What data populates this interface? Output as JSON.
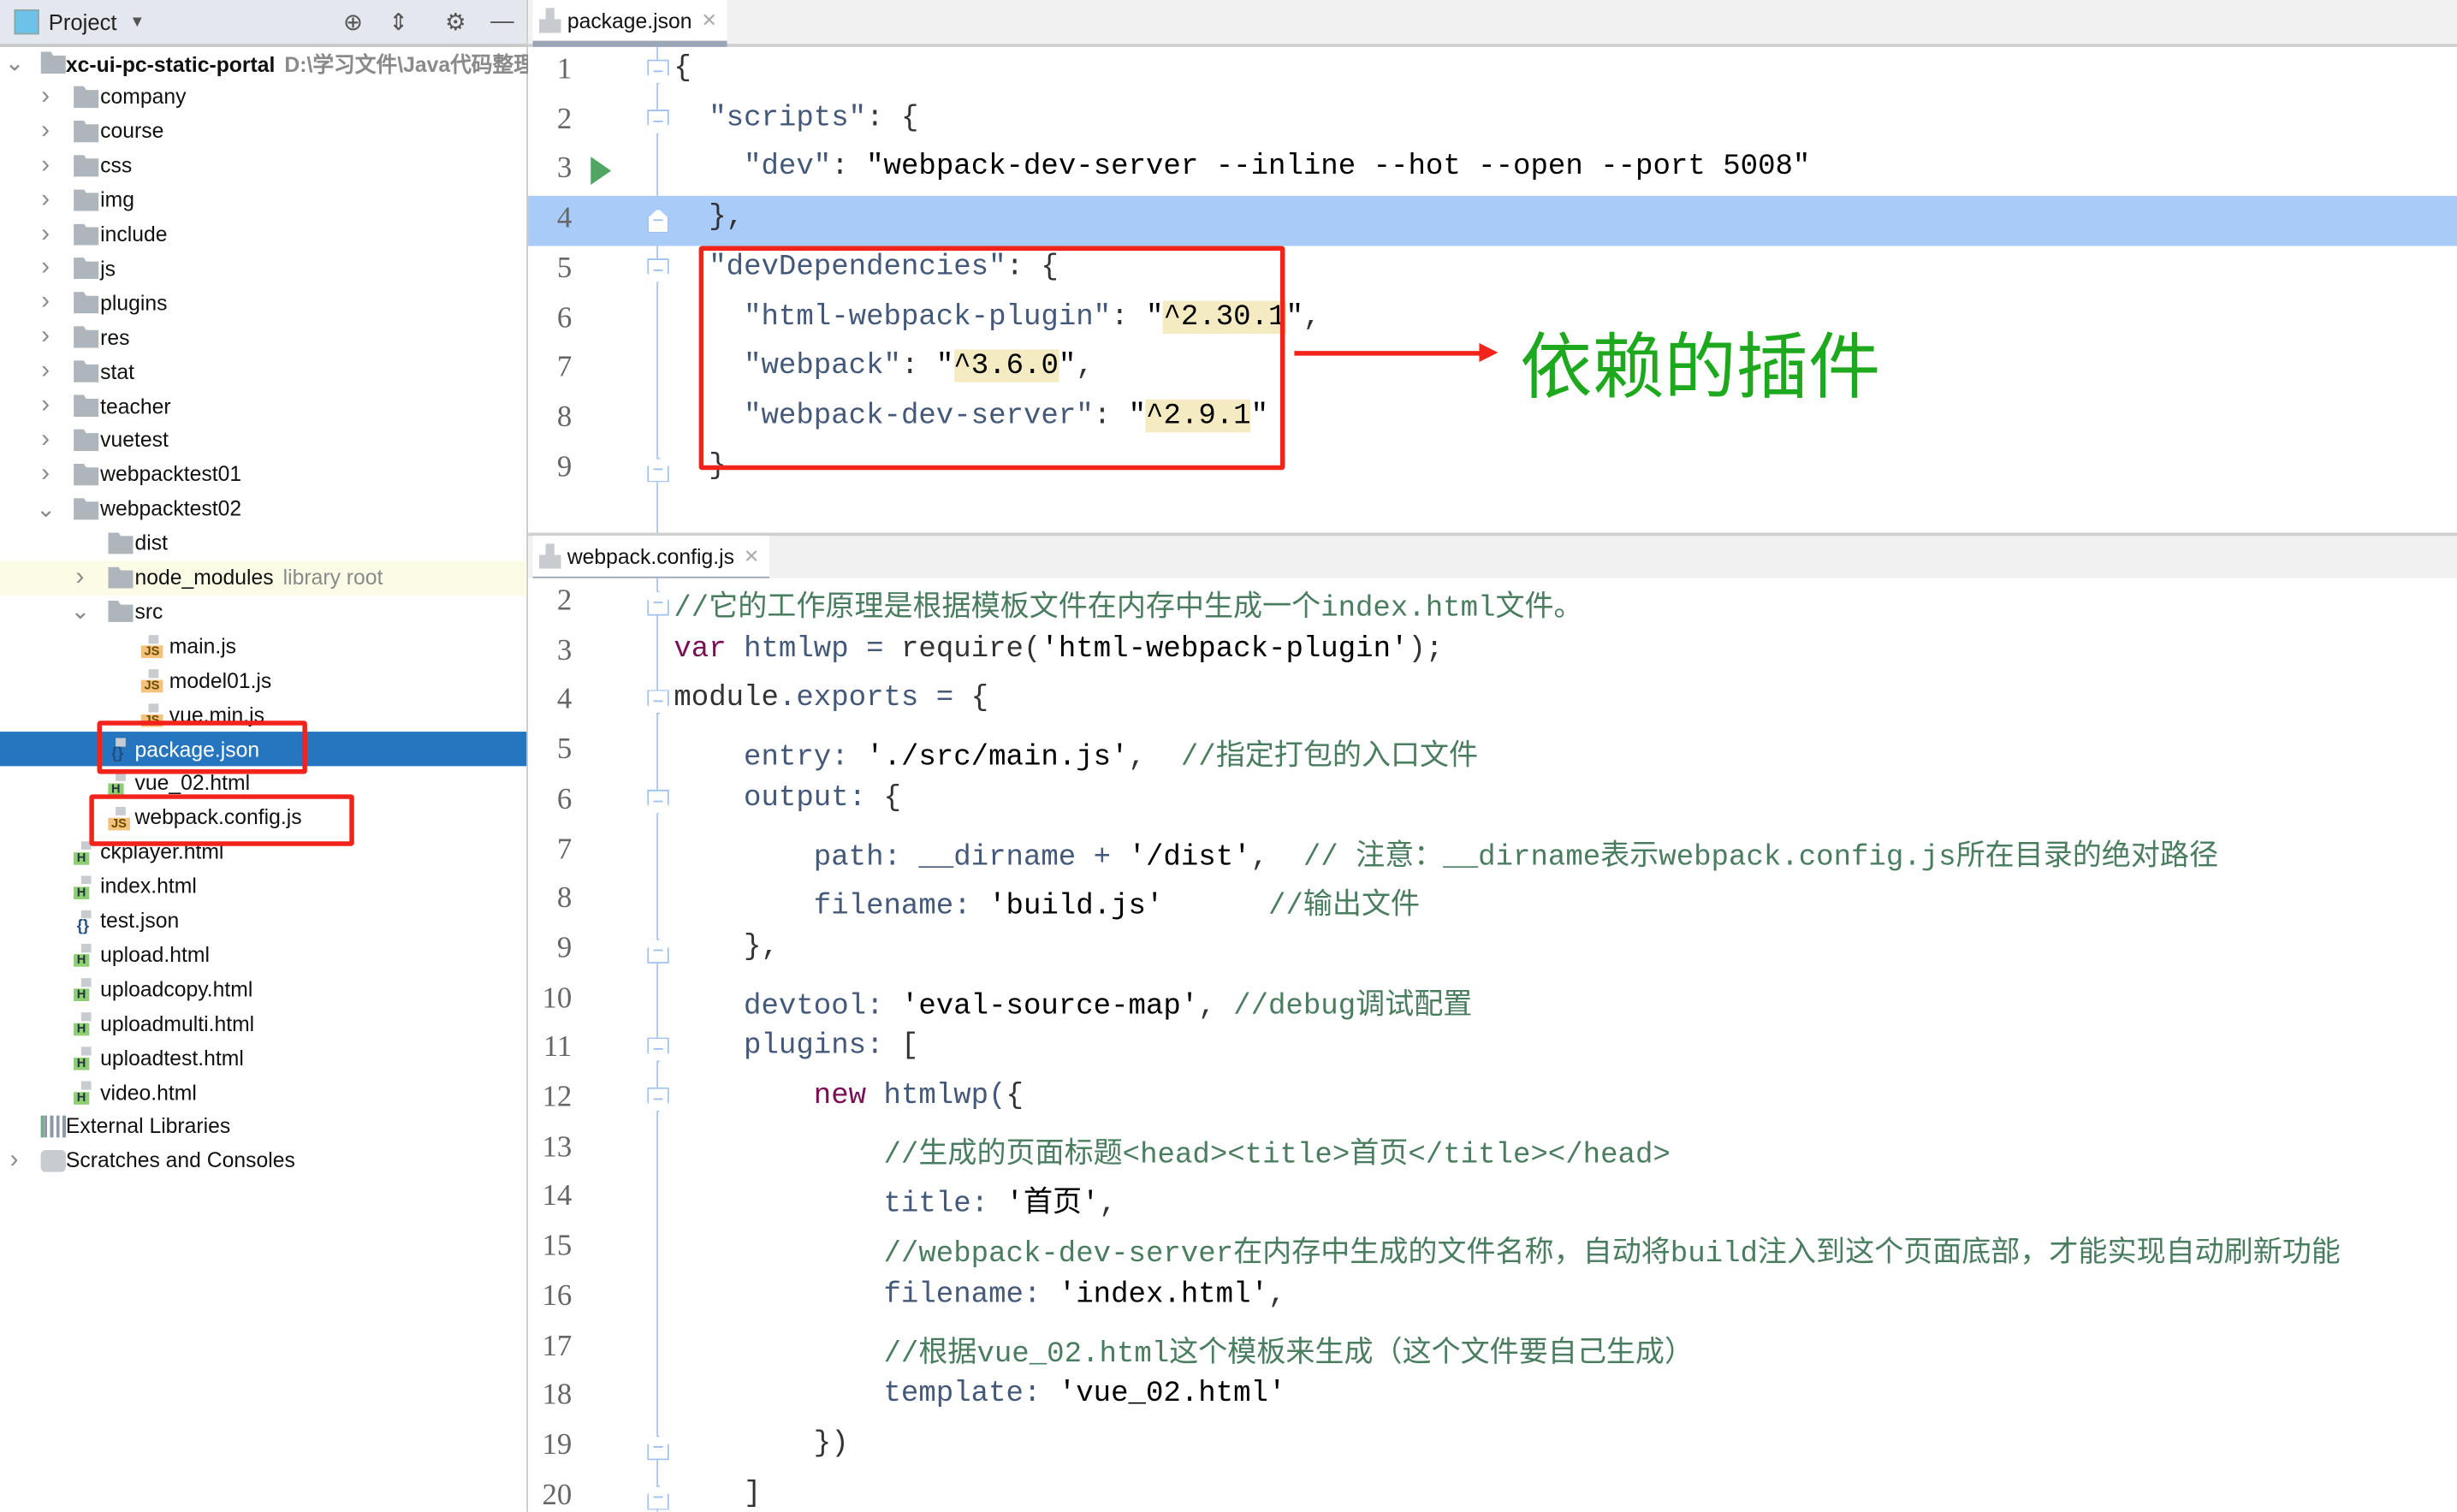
{
  "project_panel": {
    "title": "Project",
    "tree": [
      {
        "level": 0,
        "type": "root",
        "arrow": "open",
        "label": "xc-ui-pc-static-portal",
        "hint": "D:\\学习文件\\Java代码整理"
      },
      {
        "level": 1,
        "type": "folder",
        "arrow": "closed",
        "label": "company"
      },
      {
        "level": 1,
        "type": "folder",
        "arrow": "closed",
        "label": "course"
      },
      {
        "level": 1,
        "type": "folder",
        "arrow": "closed",
        "label": "css"
      },
      {
        "level": 1,
        "type": "folder",
        "arrow": "closed",
        "label": "img"
      },
      {
        "level": 1,
        "type": "folder",
        "arrow": "closed",
        "label": "include"
      },
      {
        "level": 1,
        "type": "folder",
        "arrow": "closed",
        "label": "js"
      },
      {
        "level": 1,
        "type": "folder",
        "arrow": "closed",
        "label": "plugins"
      },
      {
        "level": 1,
        "type": "folder",
        "arrow": "closed",
        "label": "res"
      },
      {
        "level": 1,
        "type": "folder",
        "arrow": "closed",
        "label": "stat"
      },
      {
        "level": 1,
        "type": "folder",
        "arrow": "closed",
        "label": "teacher"
      },
      {
        "level": 1,
        "type": "folder",
        "arrow": "closed",
        "label": "vuetest"
      },
      {
        "level": 1,
        "type": "folder",
        "arrow": "closed",
        "label": "webpacktest01"
      },
      {
        "level": 1,
        "type": "folder",
        "arrow": "open",
        "label": "webpacktest02"
      },
      {
        "level": 2,
        "type": "folder",
        "arrow": "none",
        "label": "dist"
      },
      {
        "level": 2,
        "type": "folder",
        "arrow": "closed",
        "label": "node_modules",
        "hint": "library root",
        "lib": true
      },
      {
        "level": 2,
        "type": "folder",
        "arrow": "open",
        "label": "src"
      },
      {
        "level": 3,
        "type": "js",
        "arrow": "none",
        "label": "main.js"
      },
      {
        "level": 3,
        "type": "js",
        "arrow": "none",
        "label": "model01.js"
      },
      {
        "level": 3,
        "type": "js",
        "arrow": "none",
        "label": "vue.min.js"
      },
      {
        "level": 2,
        "type": "json",
        "arrow": "none",
        "label": "package.json",
        "selected": true
      },
      {
        "level": 2,
        "type": "html",
        "arrow": "none",
        "label": "vue_02.html"
      },
      {
        "level": 2,
        "type": "js",
        "arrow": "none",
        "label": "webpack.config.js"
      },
      {
        "level": 1,
        "type": "html",
        "arrow": "none",
        "label": "ckplayer.html"
      },
      {
        "level": 1,
        "type": "html",
        "arrow": "none",
        "label": "index.html"
      },
      {
        "level": 1,
        "type": "json",
        "arrow": "none",
        "label": "test.json"
      },
      {
        "level": 1,
        "type": "html",
        "arrow": "none",
        "label": "upload.html"
      },
      {
        "level": 1,
        "type": "html",
        "arrow": "none",
        "label": "uploadcopy.html"
      },
      {
        "level": 1,
        "type": "html",
        "arrow": "none",
        "label": "uploadmulti.html"
      },
      {
        "level": 1,
        "type": "html",
        "arrow": "none",
        "label": "uploadtest.html"
      },
      {
        "level": 1,
        "type": "html",
        "arrow": "none",
        "label": "video.html"
      },
      {
        "level": 0,
        "type": "libs",
        "arrow": "none",
        "label": "External Libraries"
      },
      {
        "level": 0,
        "type": "scratch",
        "arrow": "closed",
        "label": "Scratches and Consoles"
      }
    ]
  },
  "editor_top": {
    "tab": "package.json",
    "current_line": 4,
    "lines": [
      {
        "n": "1",
        "fold": "open",
        "tokens": [
          {
            "c": "p",
            "t": "{"
          }
        ]
      },
      {
        "n": "2",
        "fold": "open",
        "tokens": [
          {
            "c": "p",
            "t": "  "
          },
          {
            "c": "k",
            "t": "\"scripts\""
          },
          {
            "c": "p",
            "t": ": {"
          }
        ]
      },
      {
        "n": "3",
        "run": true,
        "tokens": [
          {
            "c": "p",
            "t": "    "
          },
          {
            "c": "k",
            "t": "\"dev\""
          },
          {
            "c": "p",
            "t": ": "
          },
          {
            "c": "s",
            "t": "\"webpack-dev-server --inline --hot --open --port 5008\""
          }
        ]
      },
      {
        "n": "4",
        "fold": "close",
        "tokens": [
          {
            "c": "p",
            "t": "  },"
          }
        ]
      },
      {
        "n": "5",
        "fold": "open",
        "tokens": [
          {
            "c": "p",
            "t": "  "
          },
          {
            "c": "k",
            "t": "\"devDependencies\""
          },
          {
            "c": "p",
            "t": ": {"
          }
        ]
      },
      {
        "n": "6",
        "tokens": [
          {
            "c": "p",
            "t": "    "
          },
          {
            "c": "k",
            "t": "\"html-webpack-plugin\""
          },
          {
            "c": "p",
            "t": ": "
          },
          {
            "c": "s",
            "t": "\""
          },
          {
            "c": "s hl",
            "t": "^2.30.1"
          },
          {
            "c": "s",
            "t": "\""
          },
          {
            "c": "p",
            "t": ","
          }
        ]
      },
      {
        "n": "7",
        "tokens": [
          {
            "c": "p",
            "t": "    "
          },
          {
            "c": "k",
            "t": "\"webpack\""
          },
          {
            "c": "p",
            "t": ": "
          },
          {
            "c": "s",
            "t": "\""
          },
          {
            "c": "s hl",
            "t": "^3.6.0"
          },
          {
            "c": "s",
            "t": "\""
          },
          {
            "c": "p",
            "t": ","
          }
        ]
      },
      {
        "n": "8",
        "tokens": [
          {
            "c": "p",
            "t": "    "
          },
          {
            "c": "k",
            "t": "\"webpack-dev-server\""
          },
          {
            "c": "p",
            "t": ": "
          },
          {
            "c": "s",
            "t": "\""
          },
          {
            "c": "s hl",
            "t": "^2.9.1"
          },
          {
            "c": "s",
            "t": "\""
          }
        ]
      },
      {
        "n": "9",
        "fold": "close",
        "tokens": [
          {
            "c": "p",
            "t": "  }"
          }
        ]
      }
    ]
  },
  "editor_bottom": {
    "tab": "webpack.config.js",
    "lines": [
      {
        "n": "2",
        "fold": "close",
        "tokens": [
          {
            "c": "c",
            "t": "//它的工作原理是根据模板文件在内存中生成一个index.html文件。"
          }
        ]
      },
      {
        "n": "3",
        "tokens": [
          {
            "c": "kw",
            "t": "var"
          },
          {
            "c": "k",
            "t": " htmlwp = "
          },
          {
            "c": "p",
            "t": "require("
          },
          {
            "c": "s",
            "t": "'html-webpack-plugin'"
          },
          {
            "c": "p",
            "t": ");"
          }
        ]
      },
      {
        "n": "4",
        "fold": "open",
        "tokens": [
          {
            "c": "p",
            "t": "module"
          },
          {
            "c": "k",
            "t": ".exports = "
          },
          {
            "c": "p",
            "t": "{"
          }
        ]
      },
      {
        "n": "5",
        "tokens": [
          {
            "c": "k",
            "t": "    entry: "
          },
          {
            "c": "s",
            "t": "'./src/main.js'"
          },
          {
            "c": "p",
            "t": ",  "
          },
          {
            "c": "c",
            "t": "//指定打包的入口文件"
          }
        ]
      },
      {
        "n": "6",
        "fold": "open",
        "tokens": [
          {
            "c": "k",
            "t": "    output: "
          },
          {
            "c": "p",
            "t": "{"
          }
        ]
      },
      {
        "n": "7",
        "tokens": [
          {
            "c": "k",
            "t": "        path: __dirname + "
          },
          {
            "c": "s",
            "t": "'/dist'"
          },
          {
            "c": "p",
            "t": ",  "
          },
          {
            "c": "c",
            "t": "// 注意：__dirname表示webpack.config.js所在目录的绝对路径"
          }
        ]
      },
      {
        "n": "8",
        "tokens": [
          {
            "c": "k",
            "t": "        filename: "
          },
          {
            "c": "s",
            "t": "'build.js'"
          },
          {
            "c": "p",
            "t": "      "
          },
          {
            "c": "c",
            "t": "//输出文件"
          }
        ]
      },
      {
        "n": "9",
        "fold": "close",
        "tokens": [
          {
            "c": "p",
            "t": "    },"
          }
        ]
      },
      {
        "n": "10",
        "tokens": [
          {
            "c": "k",
            "t": "    devtool: "
          },
          {
            "c": "s",
            "t": "'eval-source-map'"
          },
          {
            "c": "p",
            "t": ", "
          },
          {
            "c": "c",
            "t": "//debug调试配置"
          }
        ]
      },
      {
        "n": "11",
        "fold": "open",
        "tokens": [
          {
            "c": "k",
            "t": "    plugins: "
          },
          {
            "c": "p",
            "t": "["
          }
        ]
      },
      {
        "n": "12",
        "fold": "open",
        "tokens": [
          {
            "c": "p",
            "t": "        "
          },
          {
            "c": "kw",
            "t": "new"
          },
          {
            "c": "k",
            "t": " htmlwp("
          },
          {
            "c": "p",
            "t": "{"
          }
        ]
      },
      {
        "n": "13",
        "tokens": [
          {
            "c": "c",
            "t": "            //生成的页面标题<head><title>首页</title></head>"
          }
        ]
      },
      {
        "n": "14",
        "tokens": [
          {
            "c": "k",
            "t": "            title: "
          },
          {
            "c": "s",
            "t": "'首页'"
          },
          {
            "c": "p",
            "t": ","
          }
        ]
      },
      {
        "n": "15",
        "tokens": [
          {
            "c": "c",
            "t": "            //webpack-dev-server在内存中生成的文件名称，自动将build注入到这个页面底部，才能实现自动刷新功能"
          }
        ]
      },
      {
        "n": "16",
        "tokens": [
          {
            "c": "k",
            "t": "            filename: "
          },
          {
            "c": "s",
            "t": "'index.html'"
          },
          {
            "c": "p",
            "t": ","
          }
        ]
      },
      {
        "n": "17",
        "tokens": [
          {
            "c": "c",
            "t": "            //根据vue_02.html这个模板来生成（这个文件要自己生成）"
          }
        ]
      },
      {
        "n": "18",
        "tokens": [
          {
            "c": "k",
            "t": "            template: "
          },
          {
            "c": "s",
            "t": "'vue_02.html'"
          }
        ]
      },
      {
        "n": "19",
        "fold": "close",
        "tokens": [
          {
            "c": "p",
            "t": "        })"
          }
        ]
      },
      {
        "n": "20",
        "fold": "close",
        "tokens": [
          {
            "c": "p",
            "t": "    ]"
          }
        ]
      }
    ]
  },
  "annotation": {
    "text": "依赖的插件",
    "color": "#1ea81e",
    "box_color": "#f2231b"
  },
  "colors": {
    "selection": "#2675bf",
    "current_line": "#a9cbf8",
    "version_highlight": "#f5ebc3"
  }
}
